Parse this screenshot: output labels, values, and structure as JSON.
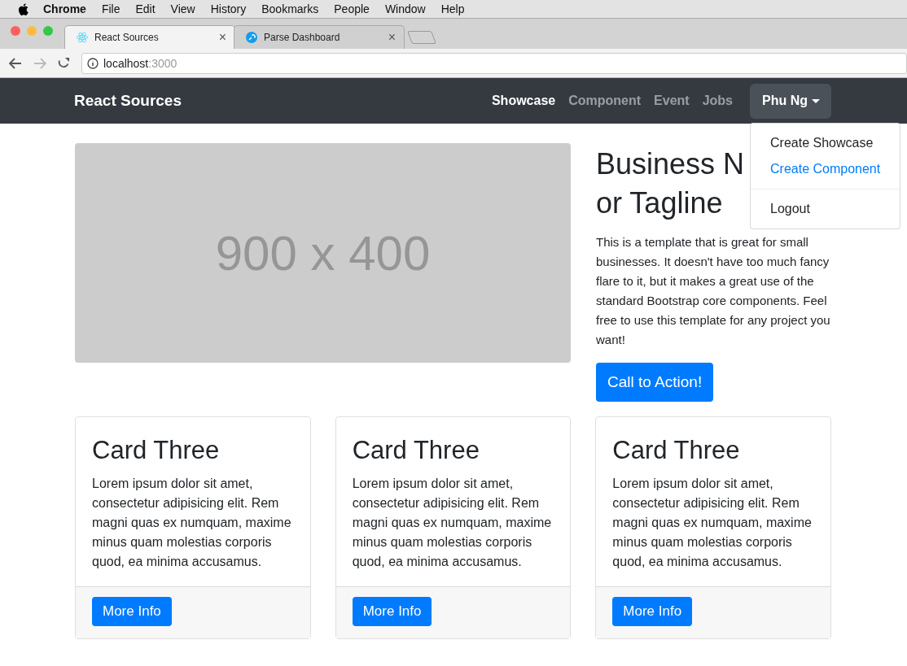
{
  "menu_bar": {
    "app": "Chrome",
    "items": [
      "File",
      "Edit",
      "View",
      "History",
      "Bookmarks",
      "People",
      "Window",
      "Help"
    ]
  },
  "tabs": [
    {
      "title": "React Sources",
      "selected": true,
      "close": "×"
    },
    {
      "title": "Parse Dashboard",
      "selected": false,
      "close": "×"
    }
  ],
  "address_bar": {
    "host": "localhost",
    "port": ":3000"
  },
  "navbar": {
    "brand": "React Sources",
    "links": [
      {
        "label": "Showcase",
        "selected": true
      },
      {
        "label": "Component",
        "selected": false
      },
      {
        "label": "Event",
        "selected": false
      },
      {
        "label": "Jobs",
        "selected": false
      }
    ],
    "user": "Phu Ng"
  },
  "dropdown": {
    "items": [
      {
        "kind": "item",
        "label": "Create Showcase",
        "highlighted": false
      },
      {
        "kind": "item",
        "label": "Create Component",
        "highlighted": true
      },
      {
        "kind": "divider"
      },
      {
        "kind": "item",
        "label": "Logout",
        "highlighted": false
      }
    ]
  },
  "hero": {
    "image_label": "900 x 400",
    "heading": [
      "Business N",
      "or Tagline"
    ],
    "text": "This is a template that is great for small businesses. It doesn't have too much fancy flare to it, but it makes a great use of the standard Bootstrap core components. Feel free to use this template for any project you want!",
    "button": "Call to Action!"
  },
  "cards": [
    {
      "title": "Card Three",
      "text": "Lorem ipsum dolor sit amet, consectetur adipisicing elit. Rem magni quas ex numquam, maxime minus quam molestias corporis quod, ea minima accusamus.",
      "button": "More Info"
    },
    {
      "title": "Card Three",
      "text": "Lorem ipsum dolor sit amet, consectetur adipisicing elit. Rem magni quas ex numquam, maxime minus quam molestias corporis quod, ea minima accusamus.",
      "button": "More Info"
    },
    {
      "title": "Card Three",
      "text": "Lorem ipsum dolor sit amet, consectetur adipisicing elit. Rem magni quas ex numquam, maxime minus quam molestias corporis quod, ea minima accusamus.",
      "button": "More Info"
    }
  ]
}
